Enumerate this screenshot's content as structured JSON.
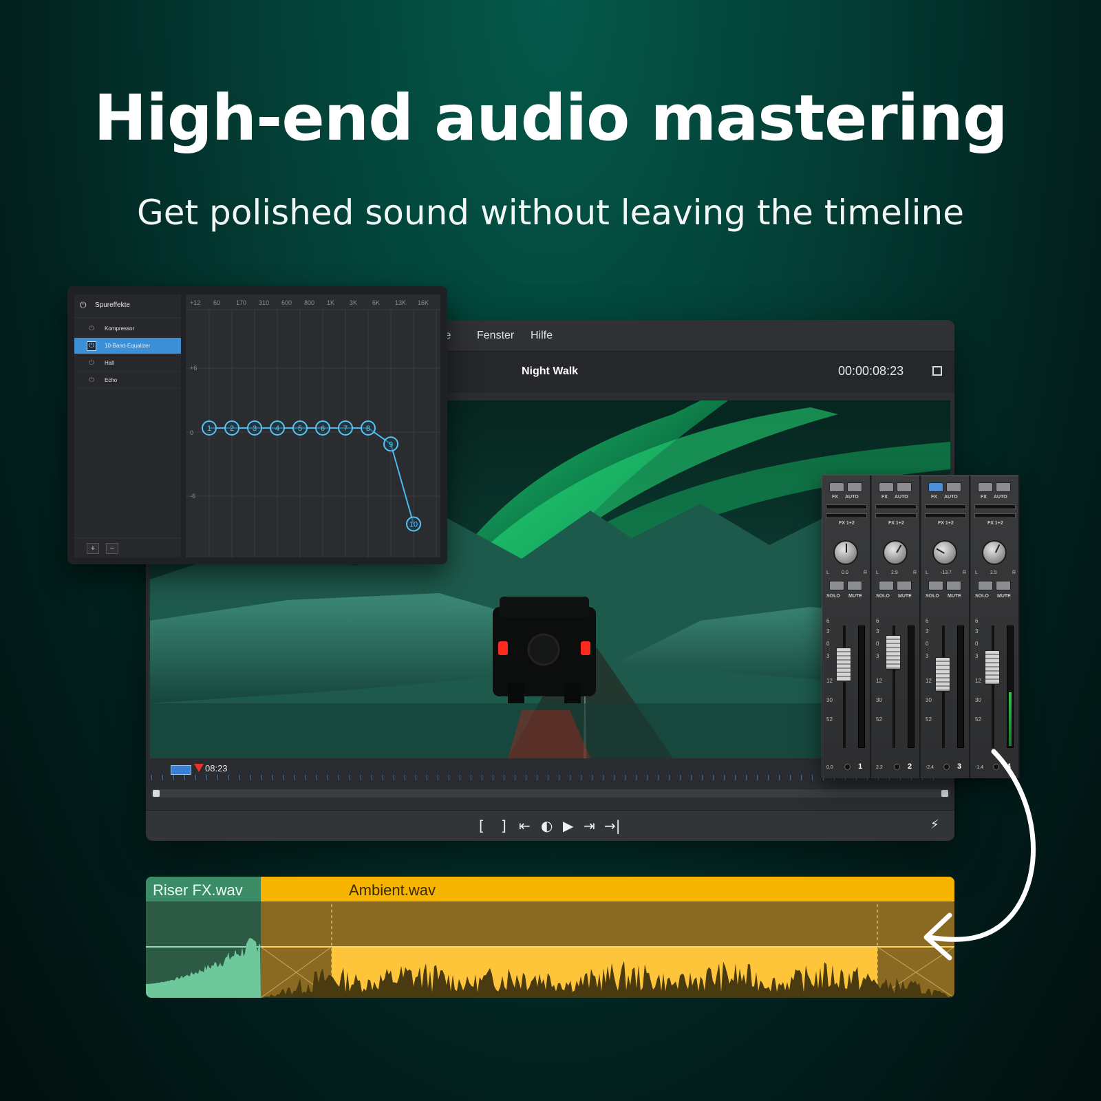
{
  "headline": "High-end audio mastering",
  "subheadline": "Get polished sound without leaving the timeline",
  "editor": {
    "menu": [
      "te",
      "Fenster",
      "Hilfe"
    ],
    "project_title": "Night Walk",
    "timecode": "00:00:08:23",
    "ruler_time": "08:23",
    "transport": [
      "[",
      "]",
      "⇤",
      "◐",
      "▶",
      "⇥",
      "→|"
    ]
  },
  "fx_panel": {
    "title": "Spureffekte",
    "items": [
      {
        "label": "Kompressor",
        "selected": false
      },
      {
        "label": "10-Band-Equalizer",
        "selected": true
      },
      {
        "label": "Hall",
        "selected": false
      },
      {
        "label": "Echo",
        "selected": false
      }
    ],
    "add_label": "+",
    "remove_label": "−",
    "eq": {
      "freq_labels": [
        "60",
        "170",
        "310",
        "600",
        "800",
        "1K",
        "3K",
        "6K",
        "13K",
        "16K"
      ],
      "gain_labels": [
        "+12",
        "+6",
        "0",
        "-6"
      ],
      "band_gains_db": [
        0,
        0,
        0,
        0,
        0,
        0,
        0,
        0,
        -1.5,
        -9
      ],
      "band_labels": [
        "1",
        "2",
        "3",
        "4",
        "5",
        "6",
        "7",
        "8",
        "9",
        "10"
      ]
    }
  },
  "mixer": {
    "fx_label": "FX",
    "auto_label": "AUTO",
    "send_label": "FX 1+2",
    "solo_label": "SOLO",
    "mute_label": "MUTE",
    "pan_l": "L",
    "pan_r": "R",
    "scale": [
      "6",
      "3",
      "0",
      "3",
      "12",
      "30",
      "52"
    ],
    "channels": [
      {
        "number": "1",
        "pan": "0.0",
        "volume": "0.0",
        "fader_level": 0.82,
        "meter_level": 0.0,
        "fx_active": false,
        "knob_angle": 0
      },
      {
        "number": "2",
        "pan": "2.9",
        "volume": "2.2",
        "fader_level": 0.92,
        "meter_level": 0.0,
        "fx_active": false,
        "knob_angle": 30
      },
      {
        "number": "3",
        "pan": "-13.7",
        "volume": "-2.4",
        "fader_level": 0.74,
        "meter_level": 0.0,
        "fx_active": true,
        "knob_angle": -60
      },
      {
        "number": "4",
        "pan": "2.5",
        "volume": "-1.4",
        "fader_level": 0.8,
        "meter_level": 0.45,
        "fx_active": false,
        "knob_angle": 25
      }
    ]
  },
  "audio_clips": [
    {
      "name": "Riser FX.wav",
      "color": "#3c8c67"
    },
    {
      "name": "Ambient.wav",
      "color": "#f6b400"
    }
  ]
}
